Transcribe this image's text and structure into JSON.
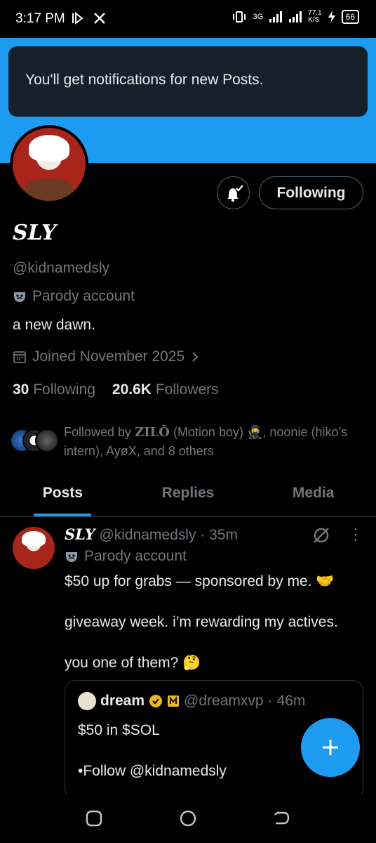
{
  "status_bar": {
    "time": "3:17 PM",
    "network_label": "3G",
    "speed_value": "77.1",
    "speed_unit": "K/S",
    "battery": "66"
  },
  "banner": {
    "notification_text": "You'll get notifications for new Posts.",
    "color": "#1d9bf0"
  },
  "profile": {
    "display_name": "SLY",
    "handle": "@kidnamedsly",
    "parody_label": "Parody account",
    "bio": "a new dawn.",
    "joined": "Joined November 2025",
    "following_count": "30",
    "following_label": "Following",
    "followers_count": "20.6K",
    "followers_label": "Followers",
    "follow_button_label": "Following",
    "followed_by": {
      "prefix": "Followed by ",
      "name1": "ZILŌ",
      "rest": " (Motion boy) 🥷, noonie (hiko’s intern), AyøX, and 8 others"
    }
  },
  "tabs": [
    {
      "label": "Posts",
      "active": true
    },
    {
      "label": "Replies",
      "active": false
    },
    {
      "label": "Media",
      "active": false
    }
  ],
  "post": {
    "author_name": "SLY",
    "author_handle": "@kidnamedsly",
    "separator": "·",
    "time": "35m",
    "parody_label": "Parody account",
    "line1": "$50 up for grabs — sponsored by me. 🤝",
    "line2": "giveaway week. i’m rewarding my actives.",
    "line3": "you one of them? 🤔",
    "quote": {
      "author_name": "dream",
      "author_handle": "@dreamxvp",
      "time": "46m",
      "line1": "$50 in $SOL",
      "line2": "•Follow @kidnamedsly"
    }
  },
  "icons": {
    "fab": "compose-plus-icon",
    "accent": "#1d9bf0"
  }
}
